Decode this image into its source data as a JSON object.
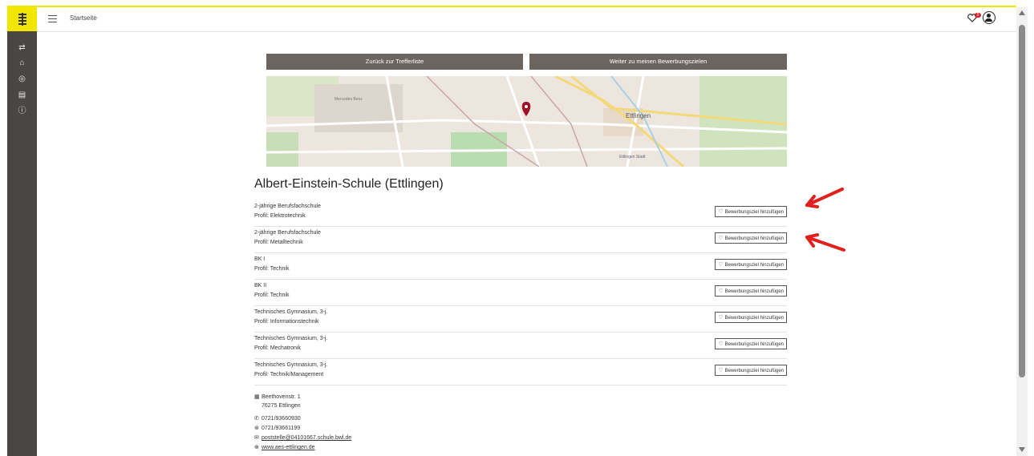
{
  "topbar": {
    "breadcrumb": "Startseite",
    "notification_count": "0"
  },
  "nav": {
    "back_label": "Zurück zur Trefferliste",
    "forward_label": "Weiter zu meinen Bewerbungszielen"
  },
  "map": {
    "city_label": "Ettlingen",
    "labels": [
      "Mercedes Benz",
      "Ettlingen Stadt"
    ]
  },
  "school": {
    "name": "Albert-Einstein-Schule (Ettlingen)"
  },
  "add_label": "Bewerbungsziel hinzufügen",
  "programs": [
    {
      "type": "2-jährige Berufsfachschule",
      "profile": "Profil: Elektrotechnik"
    },
    {
      "type": "2-jährige Berufsfachschule",
      "profile": "Profil: Metalltechnik"
    },
    {
      "type": "BK I",
      "profile": "Profil: Technik"
    },
    {
      "type": "BK II",
      "profile": "Profil: Technik"
    },
    {
      "type": "Technisches Gymnasium, 3-j.",
      "profile": "Profil: Informationstechnik"
    },
    {
      "type": "Technisches Gymnasium, 3-j.",
      "profile": "Profil: Mechatronik"
    },
    {
      "type": "Technisches Gymnasium, 3-j.",
      "profile": "Profil: Technik/Management"
    }
  ],
  "contact": {
    "street": "Beethovenstr. 1",
    "city": "76275 Ettlingen",
    "phone": "0721/93660930",
    "fax": "0721/93661199",
    "email": "poststelle@04101667.schule.bwl.de",
    "web": "www.aes-ettlingen.de"
  },
  "colors": {
    "accent_yellow": "#f2e600",
    "rail": "#4a4644",
    "button": "#6b6562",
    "annotation_red": "#e0201c"
  },
  "icons": {
    "menu": "menu-icon",
    "heart": "heart-icon",
    "account": "account-icon",
    "marker": "map-marker-icon"
  }
}
